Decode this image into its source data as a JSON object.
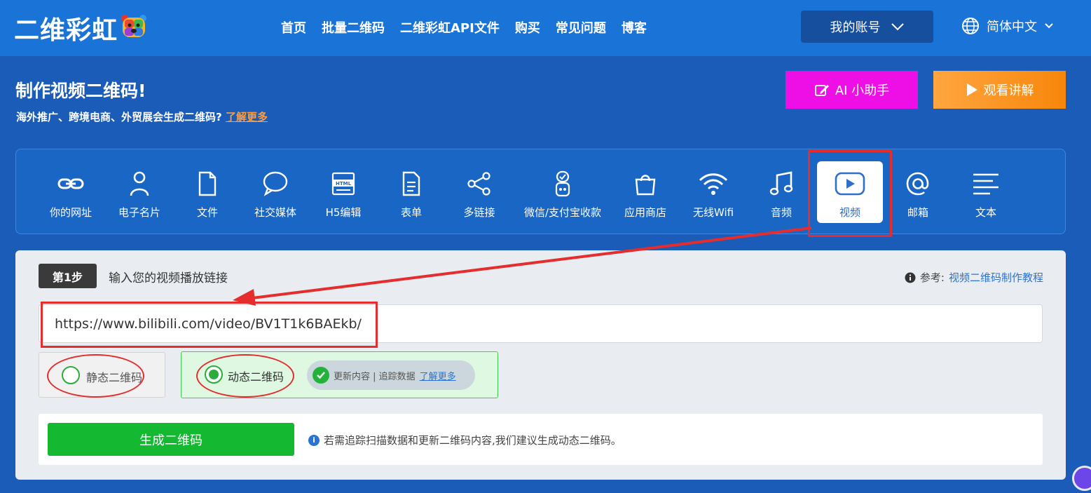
{
  "header": {
    "logo_text": "二维彩虹",
    "nav": [
      "首页",
      "批量二维码",
      "二维彩虹API文件",
      "购买",
      "常见问题",
      "博客"
    ],
    "account_label": "我的账号",
    "language_label": "简体中文"
  },
  "hero": {
    "title": "制作视频二维码!",
    "subtitle": "海外推广、跨境电商、外贸展会生成二维码?",
    "learn_more": "了解更多",
    "ai_button": "AI 小助手",
    "watch_button": "观看讲解"
  },
  "types": [
    {
      "label": "你的网址",
      "icon": "link-icon"
    },
    {
      "label": "电子名片",
      "icon": "person-icon"
    },
    {
      "label": "文件",
      "icon": "file-icon"
    },
    {
      "label": "社交媒体",
      "icon": "chat-bubble-icon"
    },
    {
      "label": "H5编辑",
      "icon": "html-icon"
    },
    {
      "label": "表单",
      "icon": "form-icon"
    },
    {
      "label": "多链接",
      "icon": "share-icon"
    },
    {
      "label": "微信/支付宝收款",
      "icon": "payment-icon"
    },
    {
      "label": "应用商店",
      "icon": "shopping-bag-icon"
    },
    {
      "label": "无线Wifi",
      "icon": "wifi-icon"
    },
    {
      "label": "音频",
      "icon": "music-icon"
    },
    {
      "label": "视频",
      "icon": "video-play-icon",
      "active": true
    },
    {
      "label": "邮箱",
      "icon": "at-icon"
    },
    {
      "label": "文本",
      "icon": "text-lines-icon"
    }
  ],
  "step": {
    "badge": "第1步",
    "label": "输入您的视频播放链接",
    "ref_prefix": "参考:",
    "ref_link": "视频二维码制作教程",
    "url_value": "https://www.bilibili.com/video/BV1T1k6BAEkb/"
  },
  "options": {
    "static_label": "静态二维码",
    "dynamic_label": "动态二维码",
    "features": "更新内容 | 追踪数据",
    "learn_more": "了解更多",
    "selected": "dynamic"
  },
  "generate": {
    "button": "生成二维码",
    "hint": "若需追踪扫描数据和更新二维码内容,我们建议生成动态二维码。"
  },
  "colors": {
    "brand_blue": "#1a73d6",
    "ai_button": "#ee0ee6",
    "watch_button": "#f7860a",
    "generate_green": "#14b931",
    "annotation_red": "#e52d2d"
  }
}
